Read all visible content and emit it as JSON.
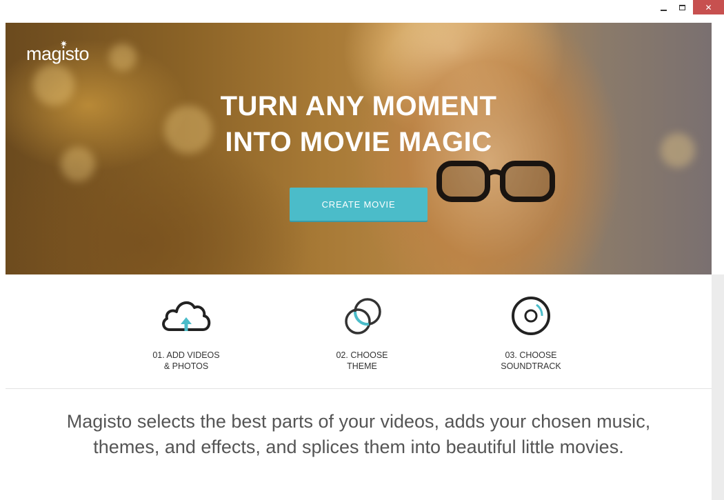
{
  "window": {
    "minimize_icon": "minimize-icon",
    "maximize_icon": "maximize-icon",
    "close_icon": "close-icon",
    "close_glyph": "✕"
  },
  "hero": {
    "logo": "magisto",
    "logo_mark": "✷",
    "title_line1": "TURN ANY MOMENT",
    "title_line2": "INTO MOVIE MAGIC",
    "cta_label": "CREATE MOVIE"
  },
  "steps": [
    {
      "icon": "cloud-upload-icon",
      "line1": "01. ADD VIDEOS",
      "line2": "& PHOTOS"
    },
    {
      "icon": "overlapping-circles-icon",
      "line1": "02. CHOOSE",
      "line2": "THEME"
    },
    {
      "icon": "disc-icon",
      "line1": "03. CHOOSE",
      "line2": "SOUNDTRACK"
    }
  ],
  "description": {
    "line1": "Magisto selects the best parts of your videos, adds your chosen music,",
    "line2": "themes, and effects, and splices them into beautiful little movies."
  },
  "colors": {
    "accent": "#4bbcc9",
    "close_button": "#c7504f",
    "text_dark": "#333333",
    "text_body": "#555555"
  }
}
